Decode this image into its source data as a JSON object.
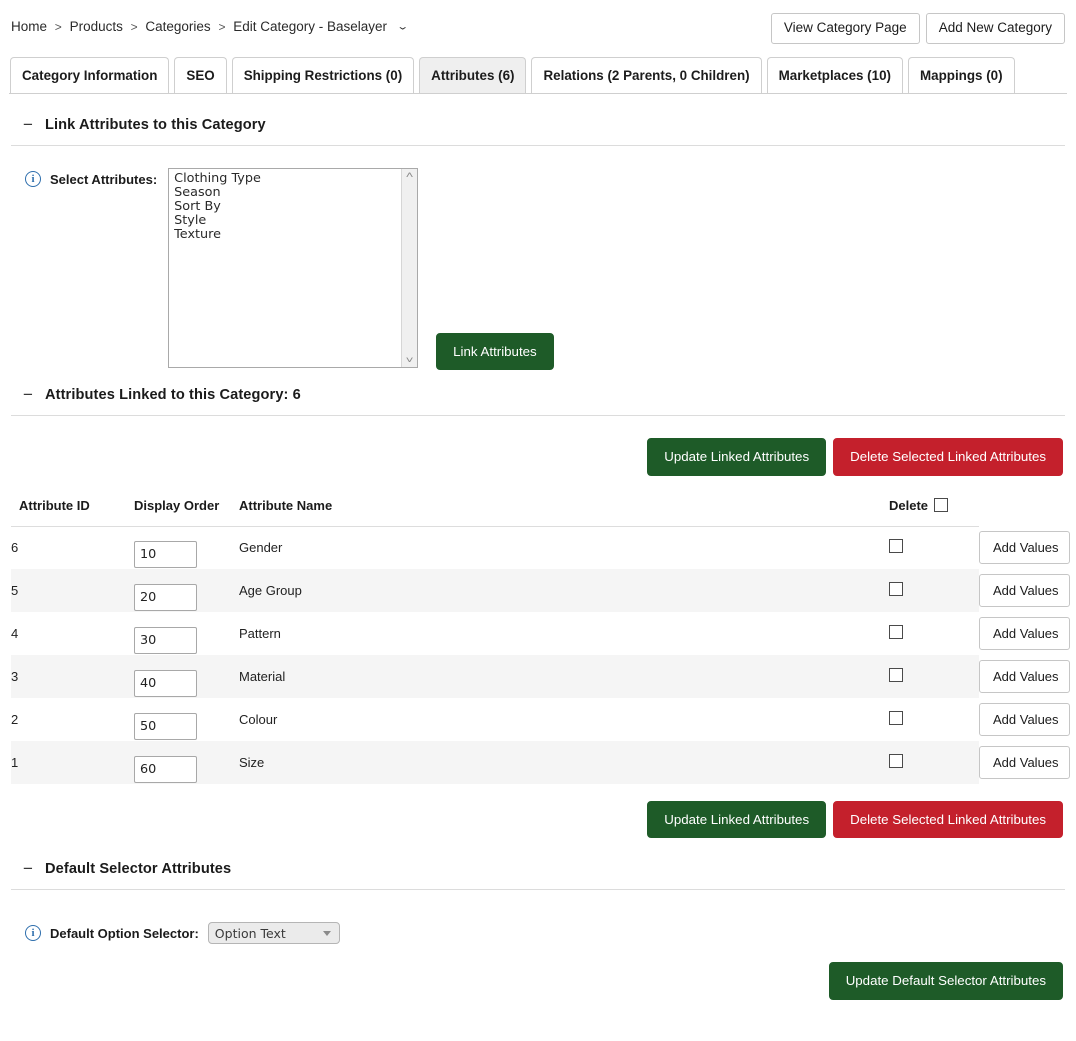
{
  "breadcrumb": {
    "items": [
      "Home",
      "Products",
      "Categories",
      "Edit Category - Baselayer"
    ],
    "separator": ">",
    "caret": "⌄"
  },
  "header_buttons": {
    "view_category_page": "View Category Page",
    "add_new_category": "Add New Category"
  },
  "tabs": [
    {
      "label": "Category Information",
      "active": false
    },
    {
      "label": "SEO",
      "active": false
    },
    {
      "label": "Shipping Restrictions (0)",
      "active": false
    },
    {
      "label": "Attributes (6)",
      "active": true
    },
    {
      "label": "Relations (2 Parents, 0 Children)",
      "active": false
    },
    {
      "label": "Marketplaces (10)",
      "active": false
    },
    {
      "label": "Mappings (0)",
      "active": false
    }
  ],
  "link_section": {
    "title": "Link Attributes to this Category",
    "collapse_glyph": "−",
    "info_glyph": "i",
    "select_label": "Select Attributes:",
    "options": [
      "Clothing Type",
      "Season",
      "Sort By",
      "Style",
      "Texture"
    ],
    "scroll_up_glyph": "˄",
    "scroll_down_glyph": "˅",
    "link_button": "Link Attributes"
  },
  "linked_section": {
    "title": "Attributes Linked to this Category: 6",
    "collapse_glyph": "−",
    "update_button": "Update Linked Attributes",
    "delete_button": "Delete Selected Linked Attributes",
    "columns": {
      "attribute_id": "Attribute ID",
      "display_order": "Display Order",
      "attribute_name": "Attribute Name",
      "delete": "Delete"
    },
    "add_values_label": "Add Values",
    "rows": [
      {
        "id": "6",
        "order": "10",
        "name": "Gender",
        "delete_checked": false,
        "add_values": "Add Values"
      },
      {
        "id": "5",
        "order": "20",
        "name": "Age Group",
        "delete_checked": false,
        "add_values": "Add Values"
      },
      {
        "id": "4",
        "order": "30",
        "name": "Pattern",
        "delete_checked": false,
        "add_values": "Add Values"
      },
      {
        "id": "3",
        "order": "40",
        "name": "Material",
        "delete_checked": false,
        "add_values": "Add Values"
      },
      {
        "id": "2",
        "order": "50",
        "name": "Colour",
        "delete_checked": false,
        "add_values": "Add Values"
      },
      {
        "id": "1",
        "order": "60",
        "name": "Size",
        "delete_checked": false,
        "add_values": "Add Values"
      }
    ]
  },
  "default_selector_section": {
    "title": "Default Selector Attributes",
    "collapse_glyph": "−",
    "info_glyph": "i",
    "label": "Default Option Selector:",
    "selected_option": "Option Text",
    "update_button": "Update Default Selector Attributes"
  },
  "colors": {
    "green": "#1e5b28",
    "red": "#c4202c",
    "info_blue": "#2f6fad",
    "tab_active_bg": "#efefef",
    "row_stripe": "#f5f5f5"
  }
}
